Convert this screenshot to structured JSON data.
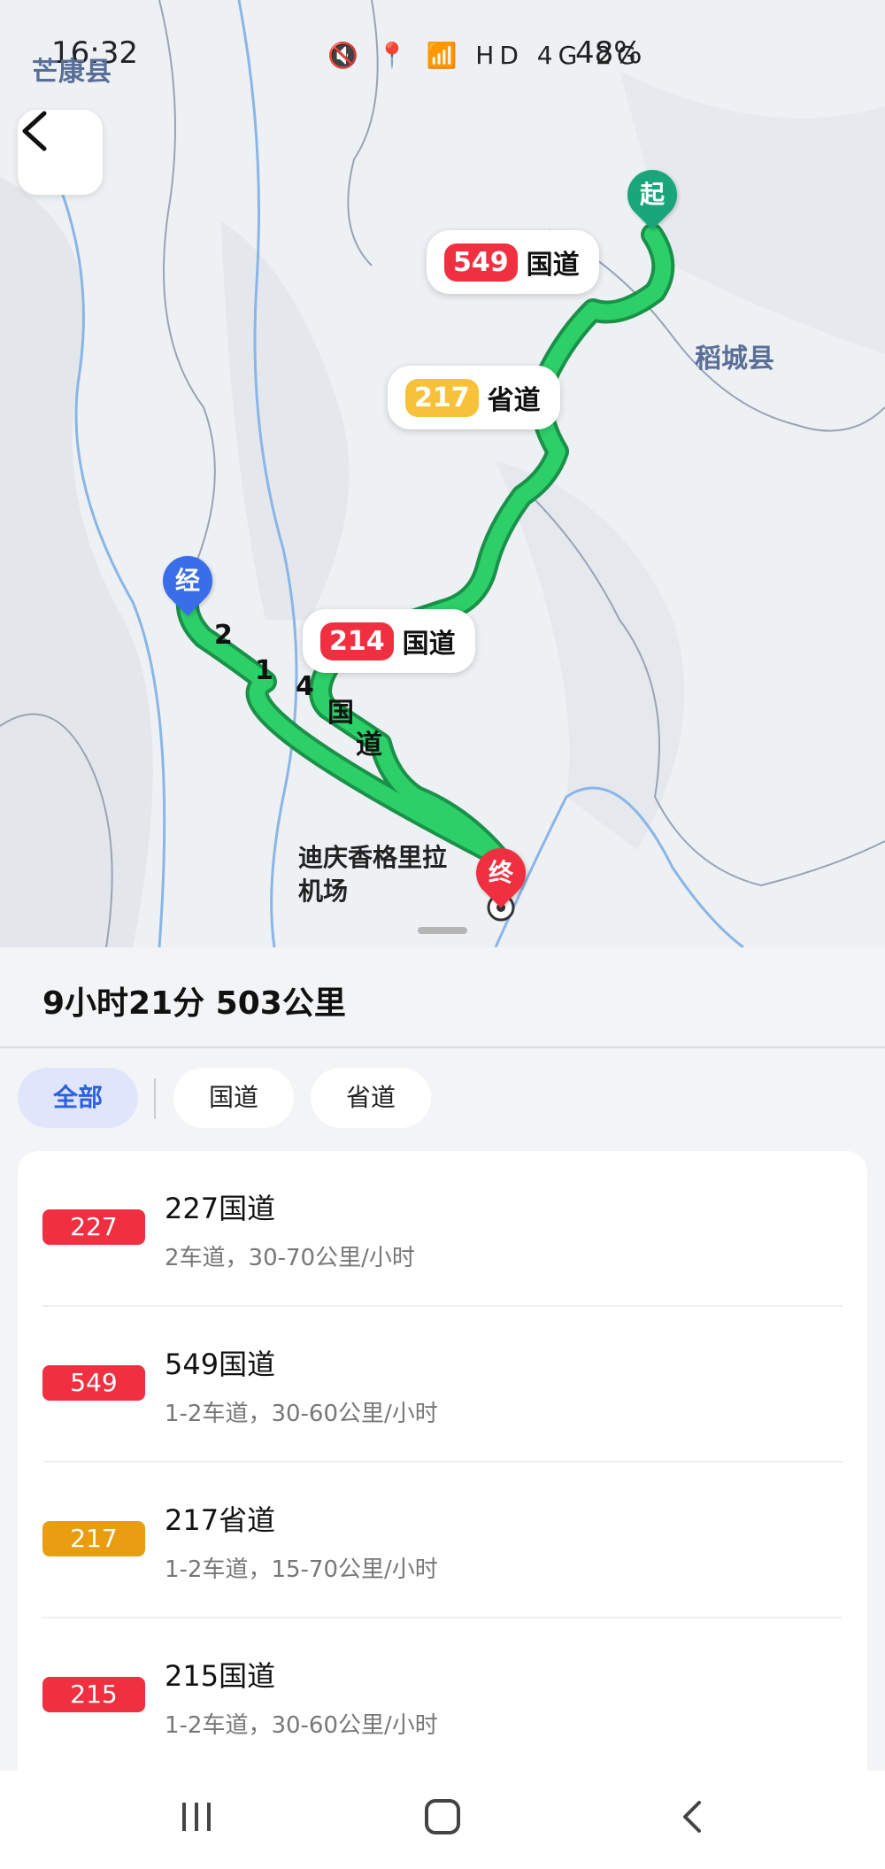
{
  "status_bar": {
    "time": "16:32",
    "icons": "🔇 📍 📶 HD 4G 2G",
    "battery": "48%"
  },
  "map": {
    "counties": {
      "left": "芒康县",
      "right": "稻城县"
    },
    "road_bubbles": [
      {
        "num": "549",
        "type": "国道",
        "color": "#f03040"
      },
      {
        "num": "217",
        "type": "省道",
        "color": "#f7c23a"
      },
      {
        "num": "214",
        "type": "国道",
        "color": "#f03040"
      }
    ],
    "markers": {
      "start": "起",
      "via": "经",
      "end": "终"
    },
    "route_label_chars": [
      "2",
      "1",
      "4",
      "国",
      "道"
    ],
    "airport_name_line1": "迪庆香格里拉",
    "airport_name_line2": "机场",
    "route_color": "#1fc060"
  },
  "summary": {
    "text": "9小时21分  503公里"
  },
  "filters": [
    {
      "label": "全部",
      "active": true
    },
    {
      "label": "国道",
      "active": false
    },
    {
      "label": "省道",
      "active": false
    }
  ],
  "roads": [
    {
      "badge": "227",
      "badge_color": "#f03040",
      "title": "227国道",
      "subtitle": "2车道，30-70公里/小时"
    },
    {
      "badge": "549",
      "badge_color": "#f03040",
      "title": "549国道",
      "subtitle": "1-2车道，30-60公里/小时"
    },
    {
      "badge": "217",
      "badge_color": "#e89e10",
      "title": "217省道",
      "subtitle": "1-2车道，15-70公里/小时"
    },
    {
      "badge": "215",
      "badge_color": "#f03040",
      "title": "215国道",
      "subtitle": "1-2车道，30-60公里/小时"
    }
  ]
}
